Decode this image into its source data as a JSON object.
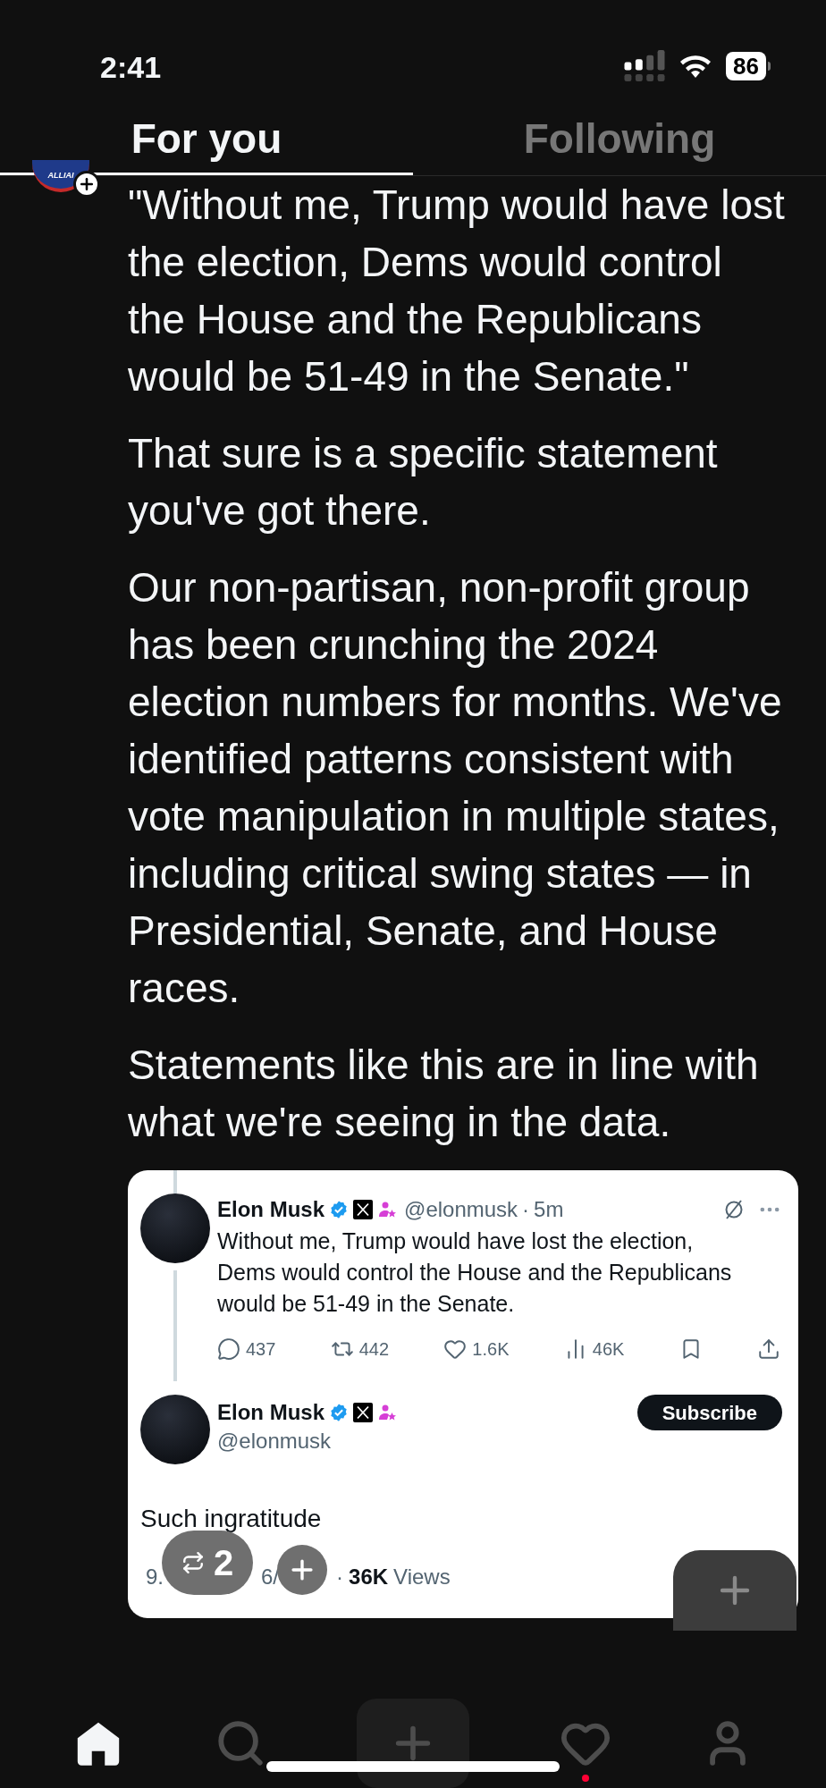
{
  "status_bar": {
    "time": "2:41",
    "battery": "86"
  },
  "tabs": [
    {
      "label": "For you",
      "selected": true
    },
    {
      "label": "Following",
      "selected": false
    }
  ],
  "post": {
    "avatar_label": "ALLIAI",
    "paragraphs": [
      "\"Without me, Trump would have lost the election, Dems would control the House and the Republicans would be 51-49 in the Senate.\"",
      "That sure is a specific statement you've got there.",
      "Our non-partisan, non-profit group has been crunching the 2024 election numbers for months. We've identified patterns consistent with vote manipulation in multiple states, including critical swing states — in Presidential, Senate, and House races.",
      "Statements like this are in line with what we're seeing in the data."
    ]
  },
  "quoted": {
    "tweet": {
      "name": "Elon Musk",
      "handle": "@elonmusk",
      "separator": "·",
      "time": "5m",
      "text": "Without me, Trump would have lost the election, Dems would control the House and the Republicans would be 51-49 in the Senate.",
      "stats": [
        {
          "kind": "reply",
          "count": "437"
        },
        {
          "kind": "repost",
          "count": "442"
        },
        {
          "kind": "like",
          "count": "1.6K"
        },
        {
          "kind": "views",
          "count": "46K"
        },
        {
          "kind": "bookmark"
        },
        {
          "kind": "share"
        }
      ]
    },
    "reply": {
      "name": "Elon Musk",
      "handle": "@elonmusk",
      "subscribe": "Subscribe",
      "text": "Such ingratitude",
      "meta": [
        {
          "kind": "muted",
          "text": "9."
        },
        {
          "kind": "muted",
          "text": "6/"
        },
        {
          "kind": "muted",
          "text": "·"
        },
        {
          "kind": "bold",
          "text": "36K"
        },
        {
          "kind": "muted",
          "text": "Views"
        }
      ]
    }
  },
  "repost_chip": {
    "count": "2"
  },
  "nav": [
    {
      "kind": "home",
      "selected": true
    },
    {
      "kind": "search",
      "selected": false
    },
    {
      "kind": "compose",
      "selected": false
    },
    {
      "kind": "activity",
      "selected": false,
      "unread": true
    },
    {
      "kind": "profile",
      "selected": false
    }
  ]
}
